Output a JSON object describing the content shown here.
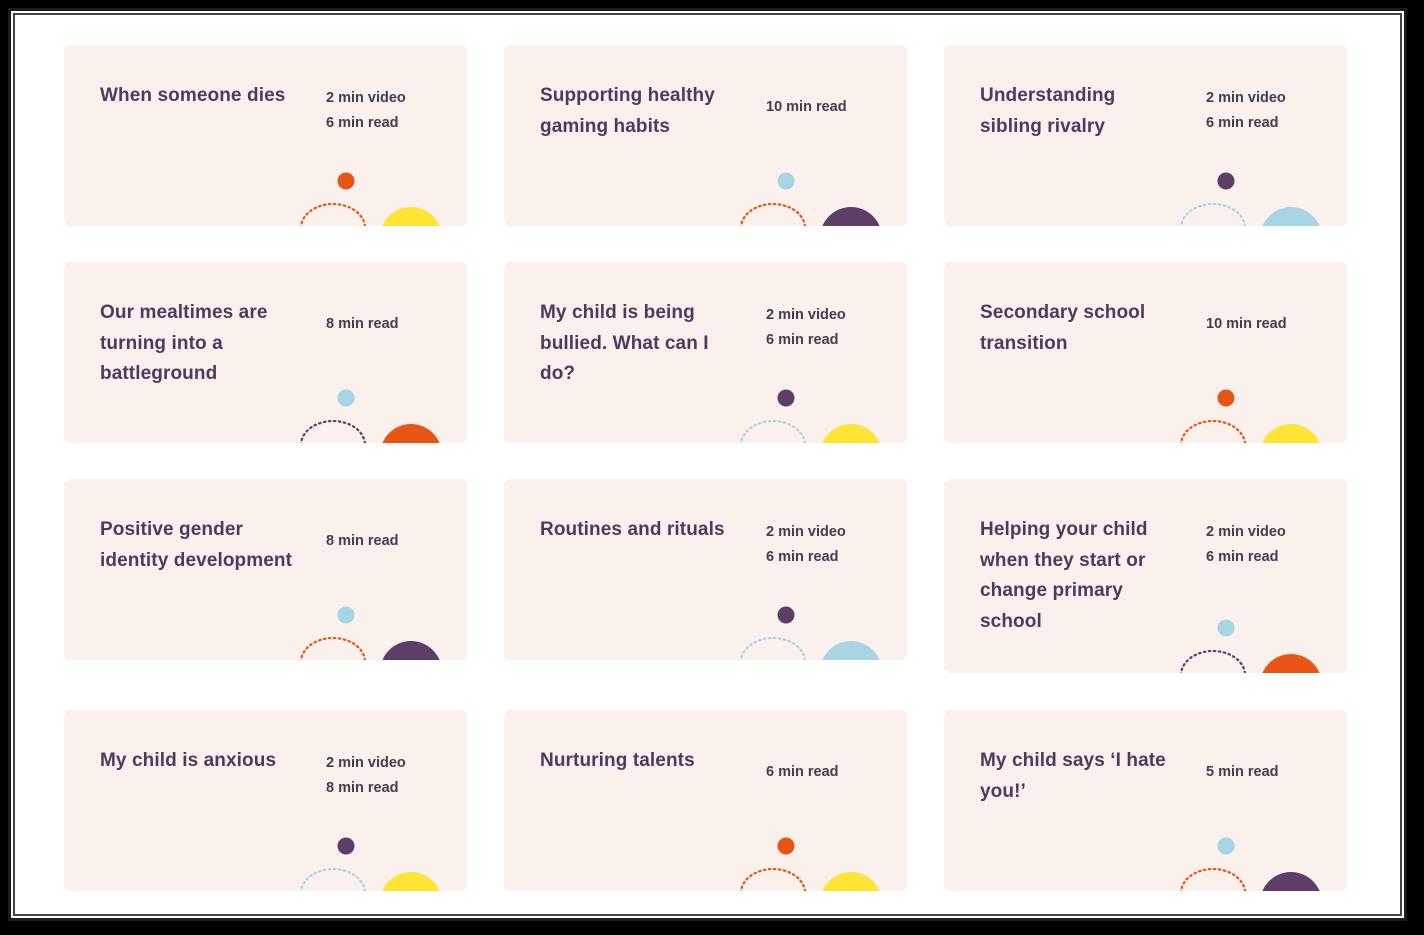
{
  "colors": {
    "card_background": "#faf0ec",
    "title_text": "#4e3a60",
    "meta_text": "#3f3f4f",
    "yellow": "#ffe433",
    "orange": "#e85413",
    "purple": "#5d3e68",
    "light_blue": "#a8d5e3"
  },
  "cards": [
    {
      "title": "When someone dies",
      "meta": [
        "2 min video",
        "6 min read"
      ],
      "dot_color": "#e85413",
      "arc_color": "#e85413",
      "circle_color": "#ffe433"
    },
    {
      "title": "Supporting healthy gaming habits",
      "meta": [
        "10 min read"
      ],
      "dot_color": "#a8d5e3",
      "arc_color": "#e85413",
      "circle_color": "#5d3e68"
    },
    {
      "title": "Understanding sibling rivalry",
      "meta": [
        "2 min video",
        "6 min read"
      ],
      "dot_color": "#5d3e68",
      "arc_color": "#a8d5e3",
      "circle_color": "#a8d5e3"
    },
    {
      "title": "Our mealtimes are turning into a battleground",
      "meta": [
        "8 min read"
      ],
      "dot_color": "#a8d5e3",
      "arc_color": "#5d3e68",
      "circle_color": "#e85413"
    },
    {
      "title": "My child is being bullied. What can I do?",
      "meta": [
        "2 min video",
        "6 min read"
      ],
      "dot_color": "#5d3e68",
      "arc_color": "#a8d5e3",
      "circle_color": "#ffe433"
    },
    {
      "title": "Secondary school transition",
      "meta": [
        "10 min read"
      ],
      "dot_color": "#e85413",
      "arc_color": "#e85413",
      "circle_color": "#ffe433"
    },
    {
      "title": "Positive gender identity development",
      "meta": [
        "8 min read"
      ],
      "dot_color": "#a8d5e3",
      "arc_color": "#e85413",
      "circle_color": "#5d3e68"
    },
    {
      "title": "Routines and rituals",
      "meta": [
        "2 min video",
        "6 min read"
      ],
      "dot_color": "#5d3e68",
      "arc_color": "#a8d5e3",
      "circle_color": "#a8d5e3"
    },
    {
      "title": "Helping your child when they start or change primary school",
      "meta": [
        "2 min video",
        "6 min read"
      ],
      "dot_color": "#a8d5e3",
      "arc_color": "#5d3e68",
      "circle_color": "#e85413"
    },
    {
      "title": "My child is anxious",
      "meta": [
        "2 min video",
        "8 min read"
      ],
      "dot_color": "#5d3e68",
      "arc_color": "#a8d5e3",
      "circle_color": "#ffe433"
    },
    {
      "title": "Nurturing talents",
      "meta": [
        "6 min read"
      ],
      "dot_color": "#e85413",
      "arc_color": "#e85413",
      "circle_color": "#ffe433"
    },
    {
      "title": "My child says ‘I hate you!’",
      "meta": [
        "5 min read"
      ],
      "dot_color": "#a8d5e3",
      "arc_color": "#e85413",
      "circle_color": "#5d3e68"
    }
  ]
}
